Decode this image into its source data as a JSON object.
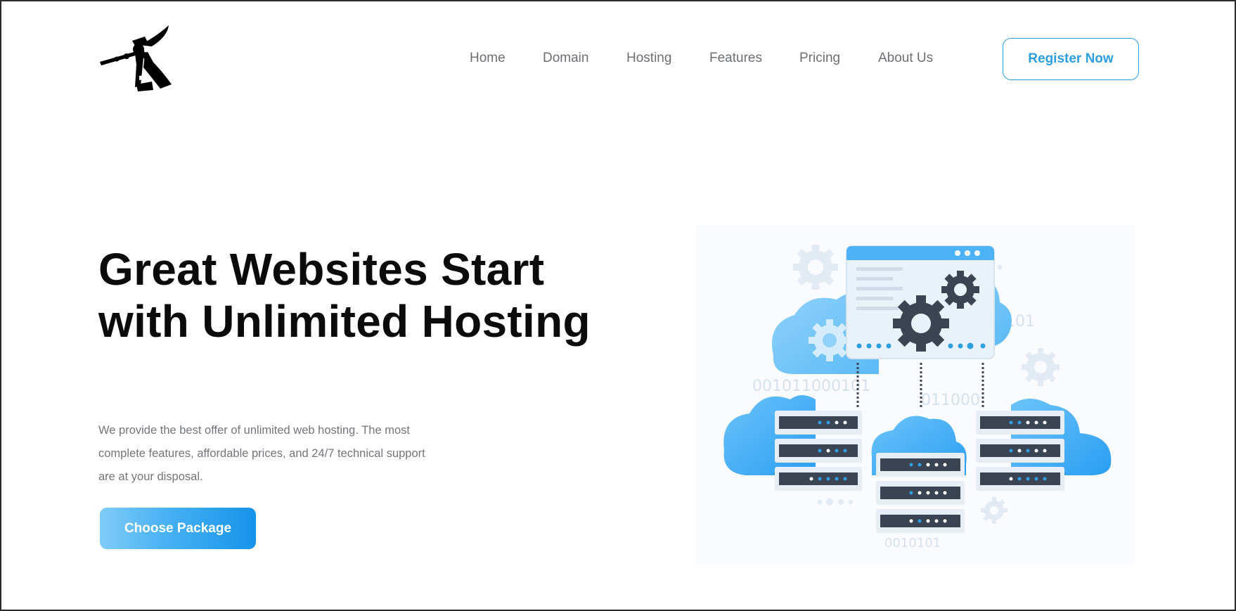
{
  "header": {
    "logo_icon": "samurai-logo-icon",
    "nav": [
      {
        "label": "Home"
      },
      {
        "label": "Domain"
      },
      {
        "label": "Hosting"
      },
      {
        "label": "Features"
      },
      {
        "label": "Pricing"
      },
      {
        "label": "About Us"
      }
    ],
    "register_label": "Register Now"
  },
  "hero": {
    "title": "Great Websites Start with Unlimited Hosting",
    "description": "We provide the best offer of unlimited web hosting. The most complete features, affordable prices, and 24/7 technical support are at your disposal.",
    "cta_label": "Choose Package"
  },
  "illustration": {
    "icon": "cloud-servers-illustration",
    "binary_texts": [
      "0101",
      "001011000101",
      "011000",
      "0010101"
    ]
  },
  "colors": {
    "accent": "#2d9ee0",
    "cta_gradient_start": "#7fcbf8",
    "cta_gradient_end": "#1693ea",
    "cloud_blue": "#4db3f6",
    "server_dark": "#3b4453",
    "text_heading": "#0b0b0b",
    "text_body": "#727579"
  }
}
